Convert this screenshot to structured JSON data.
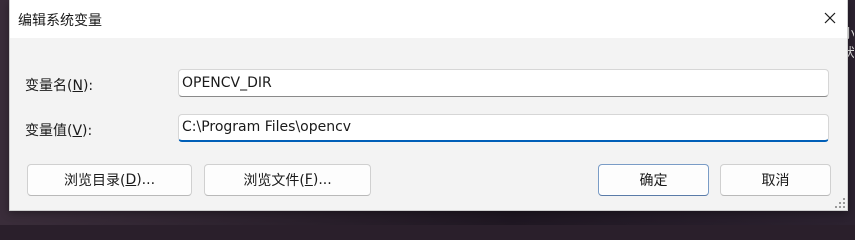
{
  "window": {
    "title": "编辑系统变量",
    "close_glyph": "✕"
  },
  "background": {
    "text_top": "小",
    "text_bottom": "状"
  },
  "variable_name": {
    "label_prefix": "变量名(",
    "label_mnemonic": "N",
    "label_suffix": "):",
    "value": "OPENCV_DIR"
  },
  "variable_value": {
    "label_prefix": "变量值(",
    "label_mnemonic": "V",
    "label_suffix": "):",
    "value": "C:\\Program Files\\opencv"
  },
  "buttons": {
    "browse_dir": {
      "prefix": "浏览目录(",
      "mnemonic": "D",
      "suffix": ")..."
    },
    "browse_file": {
      "prefix": "浏览文件(",
      "mnemonic": "F",
      "suffix": ")..."
    },
    "ok": "确定",
    "cancel": "取消"
  },
  "colors": {
    "focus_accent": "#005fb8",
    "dialog_bg": "#f3f3f3"
  }
}
